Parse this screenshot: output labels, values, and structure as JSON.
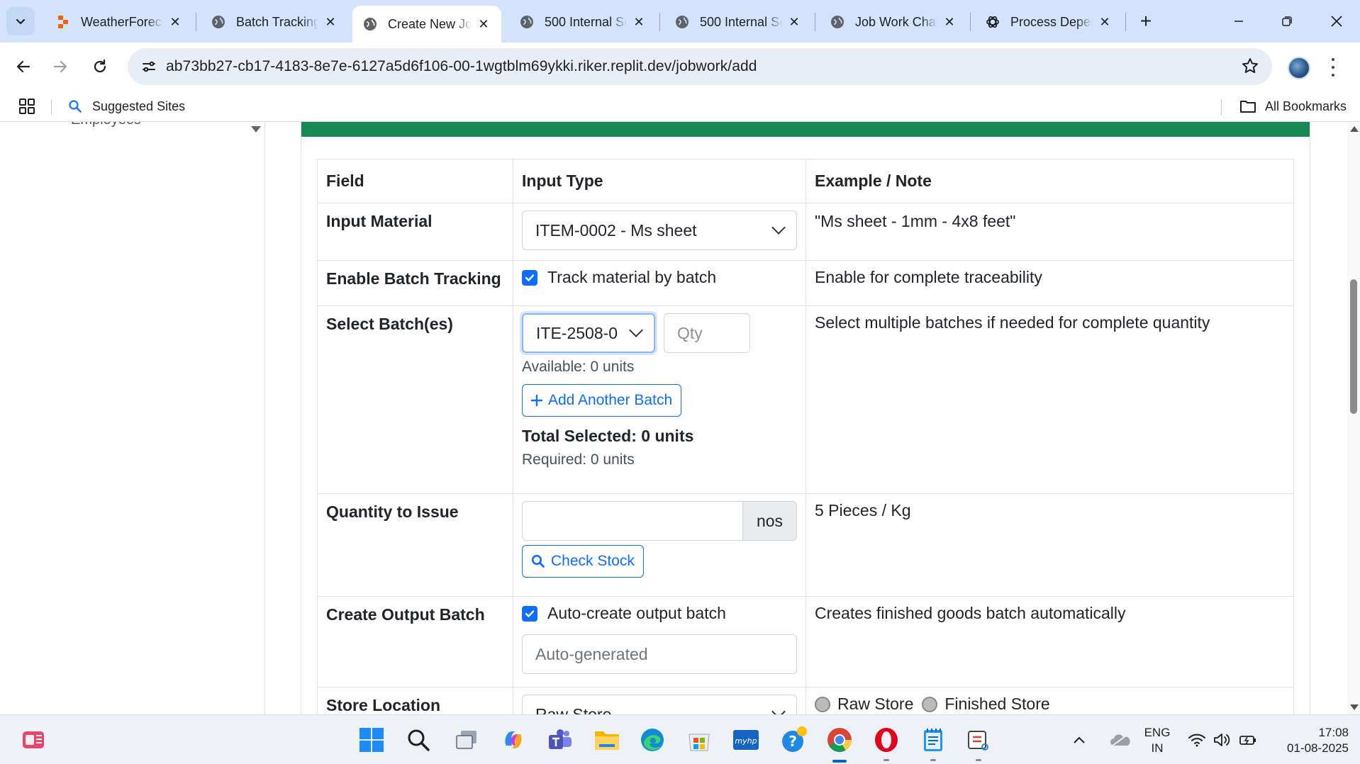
{
  "browser": {
    "tabs": [
      {
        "title": "WeatherForec",
        "active": false
      },
      {
        "title": "Batch Tracking",
        "active": false
      },
      {
        "title": "Create New Jo",
        "active": true
      },
      {
        "title": "500 Internal Se",
        "active": false
      },
      {
        "title": "500 Internal Se",
        "active": false
      },
      {
        "title": "Job Work Chal",
        "active": false
      },
      {
        "title": "Process Deper",
        "active": false
      }
    ],
    "url": "ab73bb27-cb17-4183-8e7e-6127a5d6f106-00-1wgtblm69ykki.riker.replit.dev/jobwork/add",
    "bookmarks": {
      "suggested": "Suggested Sites",
      "all": "All Bookmarks"
    }
  },
  "sidebar": {
    "partial_item": "Employees"
  },
  "guide_table": {
    "headers": [
      "Field",
      "Input Type",
      "Example / Note"
    ],
    "rows": {
      "input_material": {
        "field": "Input Material",
        "select_value": "ITEM-0002 - Ms sheet",
        "note": "\"Ms sheet - 1mm - 4x8 feet\""
      },
      "batch_tracking": {
        "field": "Enable Batch Tracking",
        "checkbox_label": "Track material by batch",
        "checked": true,
        "note": "Enable for complete traceability"
      },
      "select_batches": {
        "field": "Select Batch(es)",
        "batch_value": "ITE-2508-0",
        "qty_placeholder": "Qty",
        "available": "Available: 0 units",
        "add_button": "Add Another Batch",
        "total_selected": "Total Selected: 0 units",
        "required": "Required: 0 units",
        "note": "Select multiple batches if needed for complete quantity"
      },
      "quantity_to_issue": {
        "field": "Quantity to Issue",
        "unit": "nos",
        "check_button": "Check Stock",
        "note": "5 Pieces / Kg"
      },
      "output_batch": {
        "field": "Create Output Batch",
        "checkbox_label": "Auto-create output batch",
        "checked": true,
        "placeholder": "Auto-generated",
        "note": "Creates finished goods batch automatically"
      },
      "store_location": {
        "field": "Store Location",
        "select_value": "Raw Store",
        "radio_options": [
          "Raw Store",
          "Finished Store"
        ]
      }
    }
  },
  "taskbar": {
    "language": "ENG",
    "region": "IN",
    "time": "17:08",
    "date": "01-08-2025"
  },
  "colors": {
    "card_header": "#198754",
    "primary": "#0d6efd",
    "tab_strip": "#d3e3fd"
  }
}
